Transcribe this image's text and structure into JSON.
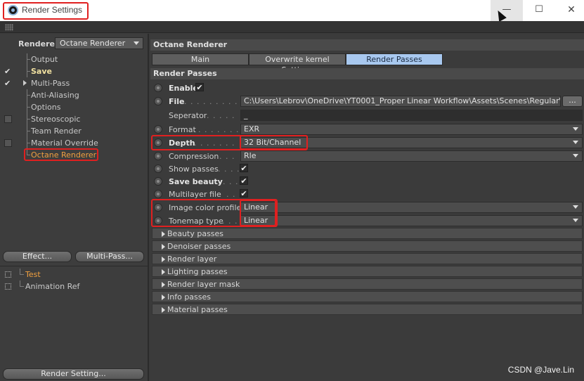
{
  "window": {
    "title": "Render Settings",
    "minimize_glyph": "—",
    "maximize_glyph": "☐",
    "close_glyph": "✕"
  },
  "left_panel": {
    "renderer_label": "Renderer",
    "renderer_value": "Octane Renderer",
    "tree": [
      {
        "label": "Output",
        "check": "",
        "style": "normal"
      },
      {
        "label": "Save",
        "check": "✔",
        "style": "bold"
      },
      {
        "label": "Multi-Pass",
        "check": "✔",
        "style": "arrow"
      },
      {
        "label": "Anti-Aliasing",
        "check": "",
        "style": "normal"
      },
      {
        "label": "Options",
        "check": "",
        "style": "normal"
      },
      {
        "label": "Stereoscopic",
        "check": "box",
        "style": "normal"
      },
      {
        "label": "Team Render",
        "check": "",
        "style": "normal"
      },
      {
        "label": "Material Override",
        "check": "box",
        "style": "normal"
      },
      {
        "label": "Octane Renderer",
        "check": "",
        "style": "orange"
      }
    ],
    "effect_button": "Effect...",
    "multipass_button": "Multi-Pass...",
    "presets": [
      {
        "label": "Test",
        "active": true
      },
      {
        "label": "Animation Ref",
        "active": false
      }
    ],
    "render_setting_button": "Render Setting..."
  },
  "right_panel": {
    "header": "Octane Renderer",
    "tabs": [
      "Main",
      "Overwrite kernel Settings",
      "Render Passes"
    ],
    "active_tab": "Render Passes",
    "section_title": "Render Passes",
    "enable_label": "Enable",
    "file_label": "File",
    "file_value": "C:\\Users\\Lebrov\\OneDrive\\YT0001_Proper Linear Workflow\\Assets\\Scenes\\Regular\\Regu",
    "file_button": "...",
    "separator_label": "Seperator",
    "separator_value": "_",
    "format_label": "Format",
    "format_value": "EXR",
    "depth_label": "Depth",
    "depth_value": "32 Bit/Channel",
    "compression_label": "Compression",
    "compression_value": "Rle",
    "show_passes_label": "Show passes",
    "save_beauty_label": "Save beauty",
    "multilayer_label": "Multilayer file",
    "image_color_profile_label": "Image color profile",
    "image_color_profile_value": "Linear",
    "tonemap_label": "Tonemap type",
    "tonemap_value": "Linear",
    "groups": [
      "Beauty passes",
      "Denoiser passes",
      "Render layer",
      "Lighting passes",
      "Render layer mask",
      "Info passes",
      "Material passes"
    ]
  },
  "watermark": "CSDN @Jave.Lin",
  "colors": {
    "highlight": "#e02020",
    "active_tab": "#a8c8ef",
    "active_item": "#f0a040"
  }
}
